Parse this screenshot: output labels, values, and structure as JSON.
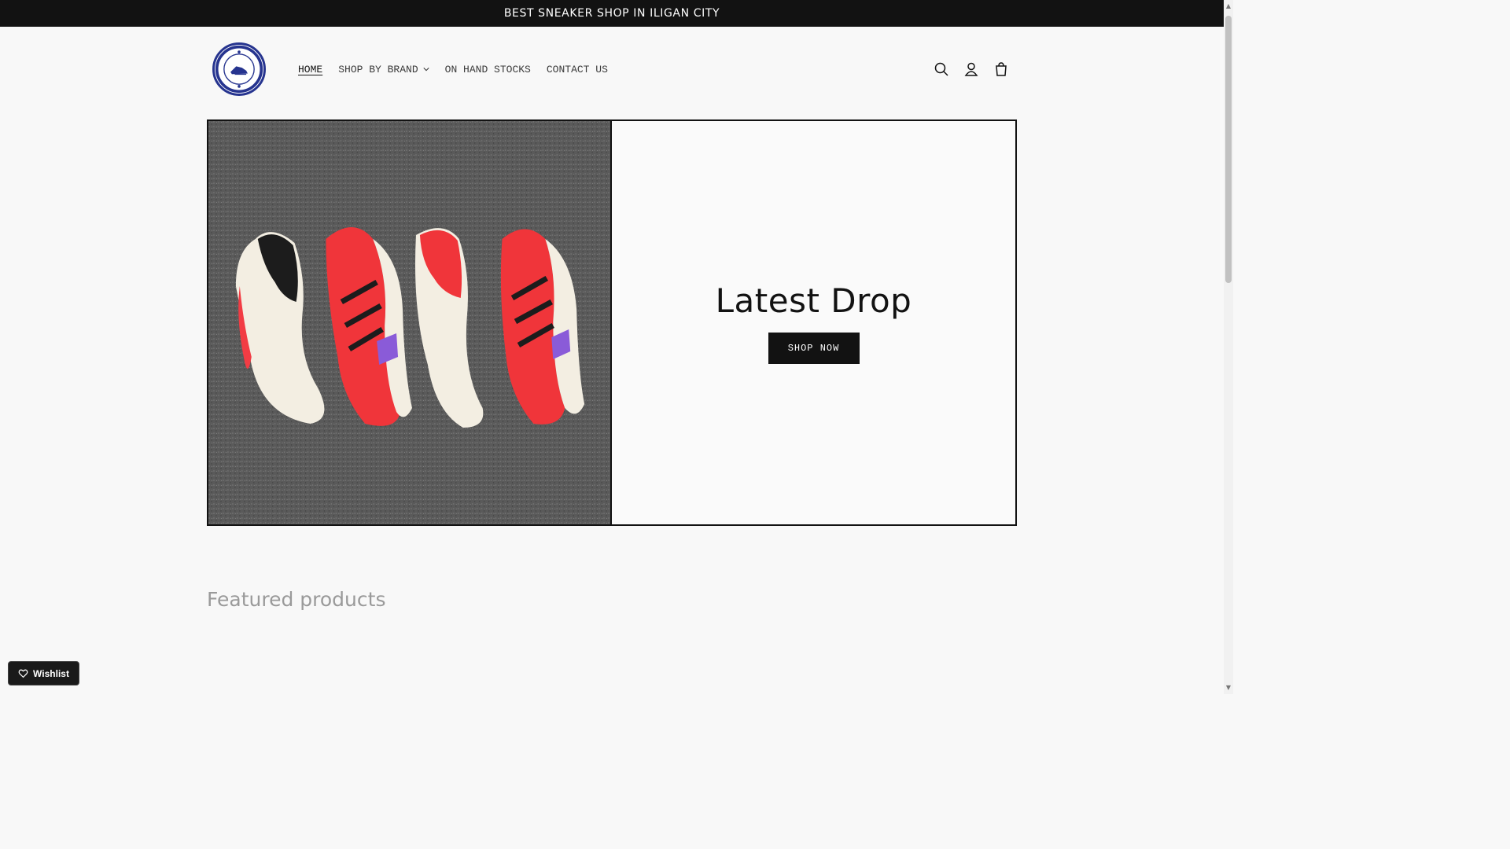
{
  "announcement": {
    "text": "BEST SNEAKER SHOP IN ILIGAN CITY"
  },
  "header": {
    "logo_alt": "NEXT LEVEL SNEAKERS",
    "nav": [
      {
        "label": "HOME",
        "active": true
      },
      {
        "label": "SHOP BY BRAND",
        "has_dropdown": true
      },
      {
        "label": "ON HAND STOCKS"
      },
      {
        "label": "CONTACT US"
      }
    ],
    "icons": [
      "search-icon",
      "account-icon",
      "cart-icon"
    ]
  },
  "banner": {
    "heading": "Latest Drop",
    "button_label": "SHOP NOW",
    "image_description_icon": "sneakers-photo"
  },
  "featured": {
    "heading": "Featured products"
  },
  "wishlist": {
    "label": "Wishlist"
  },
  "colors": {
    "accent": "#121212",
    "logo_blue": "#26348f",
    "shoe_red": "#f0353a"
  }
}
